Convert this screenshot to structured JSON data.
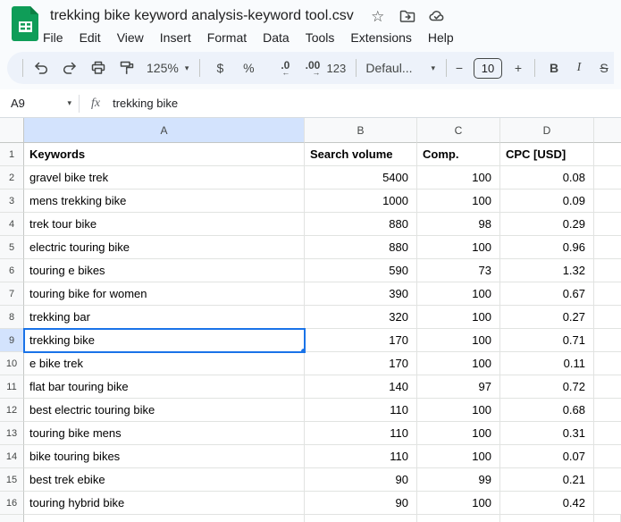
{
  "titlebar": {
    "title": "trekking bike keyword analysis-keyword tool.csv",
    "menus": [
      "File",
      "Edit",
      "View",
      "Insert",
      "Format",
      "Data",
      "Tools",
      "Extensions",
      "Help"
    ]
  },
  "icons": {
    "star": "☆",
    "dropdown_arrow": "▾"
  },
  "toolbar": {
    "zoom": "125%",
    "currency": "$",
    "percent": "%",
    "decrease_decimal": ".0",
    "decrease_arrow": "←",
    "increase_decimal": ".00",
    "increase_arrow": "→",
    "more_formats": "123",
    "font": "Defaul...",
    "decrease_font": "−",
    "font_size": "10",
    "increase_font": "+",
    "bold": "B",
    "italic": "I",
    "strikethrough": "S"
  },
  "formula_bar": {
    "cell_ref": "A9",
    "fx_label": "fx",
    "content": "trekking bike"
  },
  "colors": {
    "accent": "#1a73e8",
    "selection_highlight": "#d3e3fd",
    "logo_green": "#0f9d58",
    "toolbar_pill": "#edf2fa"
  },
  "sheet": {
    "selected_col": "A",
    "selected_row": 9,
    "col_headers": [
      "A",
      "B",
      "C",
      "D",
      ""
    ],
    "rows": [
      {
        "n": 1,
        "header": true,
        "cells": [
          "Keywords",
          "Search volume",
          "Comp.",
          "CPC [USD]",
          ""
        ]
      },
      {
        "n": 2,
        "cells": [
          "gravel bike trek",
          "5400",
          "100",
          "0.08",
          ""
        ]
      },
      {
        "n": 3,
        "cells": [
          "mens trekking bike",
          "1000",
          "100",
          "0.09",
          ""
        ]
      },
      {
        "n": 4,
        "cells": [
          "trek tour bike",
          "880",
          "98",
          "0.29",
          ""
        ]
      },
      {
        "n": 5,
        "cells": [
          "electric touring bike",
          "880",
          "100",
          "0.96",
          ""
        ]
      },
      {
        "n": 6,
        "cells": [
          "touring e bikes",
          "590",
          "73",
          "1.32",
          ""
        ]
      },
      {
        "n": 7,
        "cells": [
          "touring bike for women",
          "390",
          "100",
          "0.67",
          ""
        ]
      },
      {
        "n": 8,
        "cells": [
          "trekking bar",
          "320",
          "100",
          "0.27",
          ""
        ]
      },
      {
        "n": 9,
        "cells": [
          "trekking bike",
          "170",
          "100",
          "0.71",
          ""
        ]
      },
      {
        "n": 10,
        "cells": [
          "e bike trek",
          "170",
          "100",
          "0.11",
          ""
        ]
      },
      {
        "n": 11,
        "cells": [
          "flat bar touring bike",
          "140",
          "97",
          "0.72",
          ""
        ]
      },
      {
        "n": 12,
        "cells": [
          "best electric touring bike",
          "110",
          "100",
          "0.68",
          ""
        ]
      },
      {
        "n": 13,
        "cells": [
          "touring bike mens",
          "110",
          "100",
          "0.31",
          ""
        ]
      },
      {
        "n": 14,
        "cells": [
          "bike touring bikes",
          "110",
          "100",
          "0.07",
          ""
        ]
      },
      {
        "n": 15,
        "cells": [
          "best trek ebike",
          "90",
          "99",
          "0.21",
          ""
        ]
      },
      {
        "n": 16,
        "cells": [
          "touring hybrid bike",
          "90",
          "100",
          "0.42",
          ""
        ]
      }
    ]
  }
}
